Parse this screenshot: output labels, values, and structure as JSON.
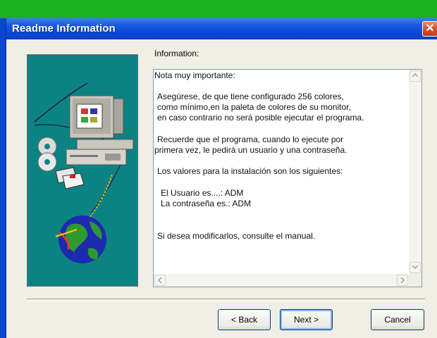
{
  "window": {
    "title": "Readme Information",
    "close_icon": "close-icon"
  },
  "info_label": "Information:",
  "readme_lines": [
    "Nota muy importante:",
    "Asegúrese, de que tiene configurado 256 colores,",
    "como mínimo,en la paleta de colores de su monitor,",
    "en caso contrario no será posible ejecutar el programa.",
    "Recuerde que el programa, cuando lo ejecute por",
    "primera vez, le pedirá un usuario y una contraseña.",
    "Los valores para la instalación son los siguientes:",
    "El Usuario es....: ADM",
    "La contraseña es.: ADM",
    "Si desea modificarlos, consulte el manual."
  ],
  "buttons": {
    "back": "< Back",
    "next": "Next >",
    "cancel": "Cancel"
  },
  "colors": {
    "titlebar": "#0a47d6",
    "art_background": "#0c8383",
    "desktop": "#1fae23"
  }
}
